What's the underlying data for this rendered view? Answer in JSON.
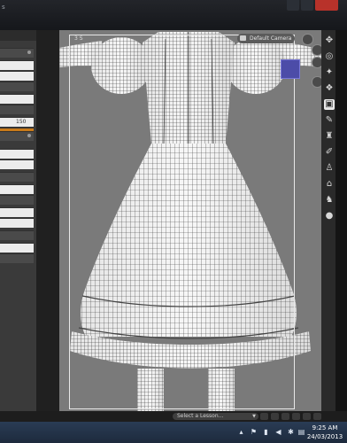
{
  "window": {
    "title_fragment": "s"
  },
  "left_panel": {
    "value_150": "150",
    "value_small": "1"
  },
  "viewport": {
    "label": "3 S",
    "camera_label": "Default Camera",
    "background_color": "#7a7a7a",
    "frame_color": "#e8e8e8"
  },
  "right_toolbar": {
    "tools": [
      {
        "name": "universal-tool-icon",
        "glyph": "✥"
      },
      {
        "name": "pose-tool-icon",
        "glyph": "◎"
      },
      {
        "name": "joint-editor-icon",
        "glyph": "✦"
      },
      {
        "name": "node-weight-icon",
        "glyph": "❖"
      },
      {
        "name": "surface-selection-icon",
        "glyph": "▣"
      },
      {
        "name": "region-navigator-icon",
        "glyph": "✎"
      },
      {
        "name": "figure-tool-icon",
        "glyph": "♜"
      },
      {
        "name": "geometry-editor-icon",
        "glyph": "✐"
      },
      {
        "name": "spotlight-tool-icon",
        "glyph": "♙"
      },
      {
        "name": "camera-tool-icon",
        "glyph": "⌂"
      },
      {
        "name": "light-tool-icon",
        "glyph": "♞"
      },
      {
        "name": "sphere-tool-icon",
        "glyph": "●"
      }
    ]
  },
  "lesson_bar": {
    "select_label": "Select a Lesson..."
  },
  "taskbar": {
    "time": "9:25 AM",
    "date": "24/03/2013"
  },
  "colors": {
    "accent": "#c87a1a",
    "nav_cube": "#4c4ca8",
    "close_button": "#b8322a",
    "taskbar": "#1d2a3d"
  }
}
